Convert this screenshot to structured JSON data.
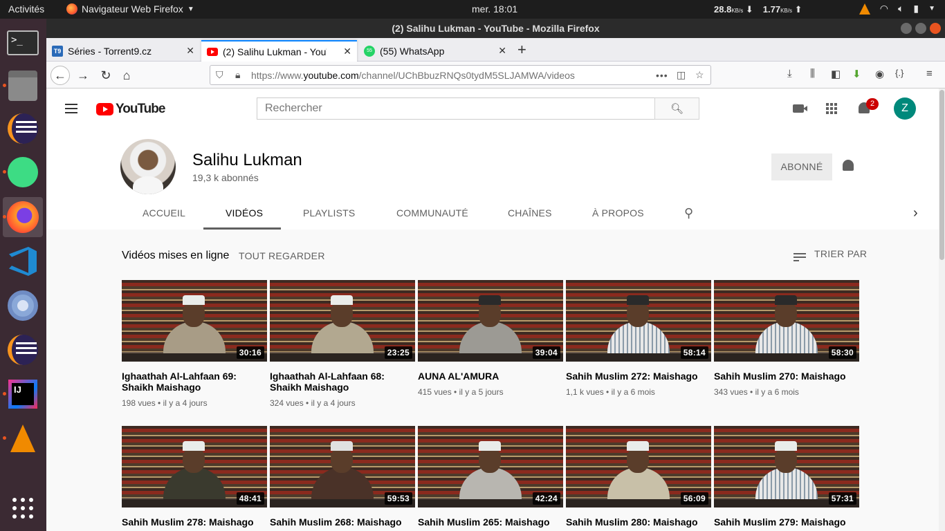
{
  "topbar": {
    "activities": "Activités",
    "app_menu": "Navigateur Web Firefox",
    "clock": "mer. 18:01",
    "net_down": "28.8",
    "net_down_unit": "KB/s",
    "net_up": "1.77",
    "net_up_unit": "KB/s"
  },
  "window": {
    "title": "(2) Salihu Lukman - YouTube - Mozilla Firefox"
  },
  "tabs": [
    {
      "label": "Séries - Torrent9.cz",
      "favicon": "T9"
    },
    {
      "label": "(2) Salihu Lukman - YouTube",
      "active": true
    },
    {
      "label": "(55) WhatsApp",
      "favicon": "55"
    }
  ],
  "urlbar": {
    "prefix": "https://www.",
    "domain": "youtube.com",
    "path": "/channel/UChBbuzRNQs0tydM5SLJAMWA/videos"
  },
  "youtube": {
    "logo_text": "YouTube",
    "search_placeholder": "Rechercher",
    "notifications_count": "2",
    "account_initial": "Z"
  },
  "channel": {
    "name": "Salihu Lukman",
    "subscribers": "19,3 k abonnés",
    "subscribed_label": "ABONNÉ",
    "tabs": [
      "ACCUEIL",
      "VIDÉOS",
      "PLAYLISTS",
      "COMMUNAUTÉ",
      "CHAÎNES",
      "À PROPOS"
    ],
    "active_tab": "VIDÉOS"
  },
  "section": {
    "title": "Vidéos mises en ligne",
    "view_all": "TOUT REGARDER",
    "sort": "TRIER PAR"
  },
  "videos": [
    {
      "title": "Ighaathah Al-Lahfaan 69: Shaikh Maishago",
      "duration": "30:16",
      "views": "198 vues",
      "age": "il y a 4 jours"
    },
    {
      "title": "Ighaathah Al-Lahfaan 68: Shaikh Maishago",
      "duration": "23:25",
      "views": "324 vues",
      "age": "il y a 4 jours"
    },
    {
      "title": "AUNA AL'AMURA",
      "duration": "39:04",
      "views": "415 vues",
      "age": "il y a 5 jours"
    },
    {
      "title": "Sahih Muslim 272: Maishago",
      "duration": "58:14",
      "views": "1,1 k vues",
      "age": "il y a 6 mois"
    },
    {
      "title": "Sahih Muslim 270: Maishago",
      "duration": "58:30",
      "views": "343 vues",
      "age": "il y a 6 mois"
    },
    {
      "title": "Sahih Muslim 278: Maishago",
      "duration": "48:41"
    },
    {
      "title": "Sahih Muslim 268: Maishago",
      "duration": "59:53"
    },
    {
      "title": "Sahih Muslim 265: Maishago",
      "duration": "42:24"
    },
    {
      "title": "Sahih Muslim 280: Maishago",
      "duration": "56:09"
    },
    {
      "title": "Sahih Muslim 279: Maishago",
      "duration": "57:31"
    }
  ],
  "colors": {
    "youtube_red": "#ff0000",
    "ubuntu_orange": "#e95420",
    "firefox_tab_accent": "#0a84ff",
    "avatar_teal": "#00897b"
  }
}
